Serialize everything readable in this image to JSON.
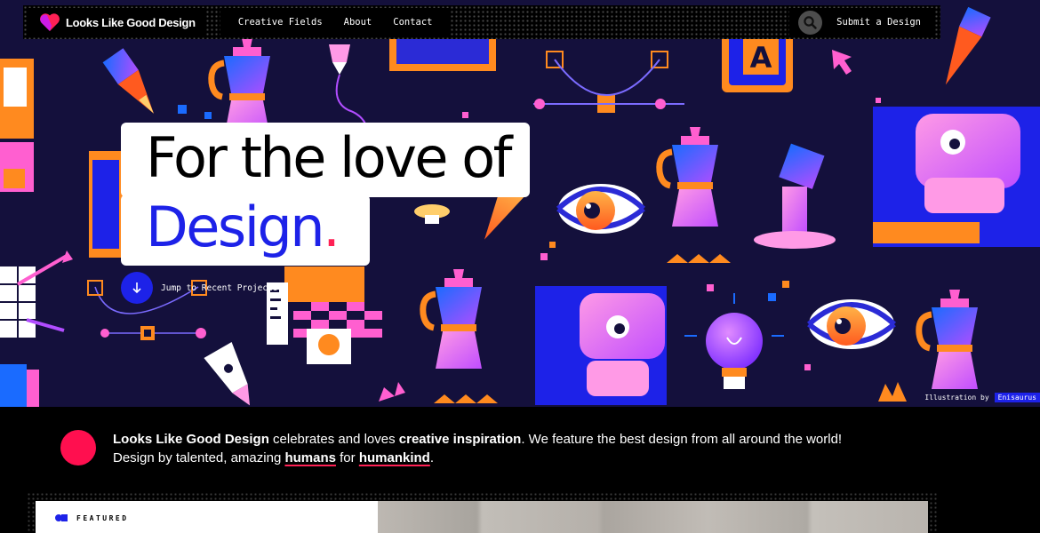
{
  "nav": {
    "brand": "Looks Like Good Design",
    "links": [
      "Creative Fields",
      "About",
      "Contact"
    ],
    "submit": "Submit a Design"
  },
  "hero": {
    "headline_line1": "For the love of",
    "headline_line2": "Design",
    "headline_dot": ".",
    "jump_label": "Jump to Recent Projects",
    "credit_prefix": "Illustration by",
    "credit_name": "Enisaurus",
    "letter_tile": "A"
  },
  "about": {
    "brand": "Looks Like Good Design",
    "t1": " celebrates and loves ",
    "emph": "creative inspiration",
    "t2": ". We feature the best design from all around the world!",
    "t3": "Design by talented, amazing ",
    "humans": "humans",
    "t4": " for ",
    "humankind": "humankind",
    "t5": "."
  },
  "featured": {
    "label": "FEATURED"
  },
  "colors": {
    "hero_bg": "#14103c",
    "accent_blue": "#1d22e8",
    "accent_pink": "#ff2155",
    "accent_red": "#ff0f4f"
  }
}
